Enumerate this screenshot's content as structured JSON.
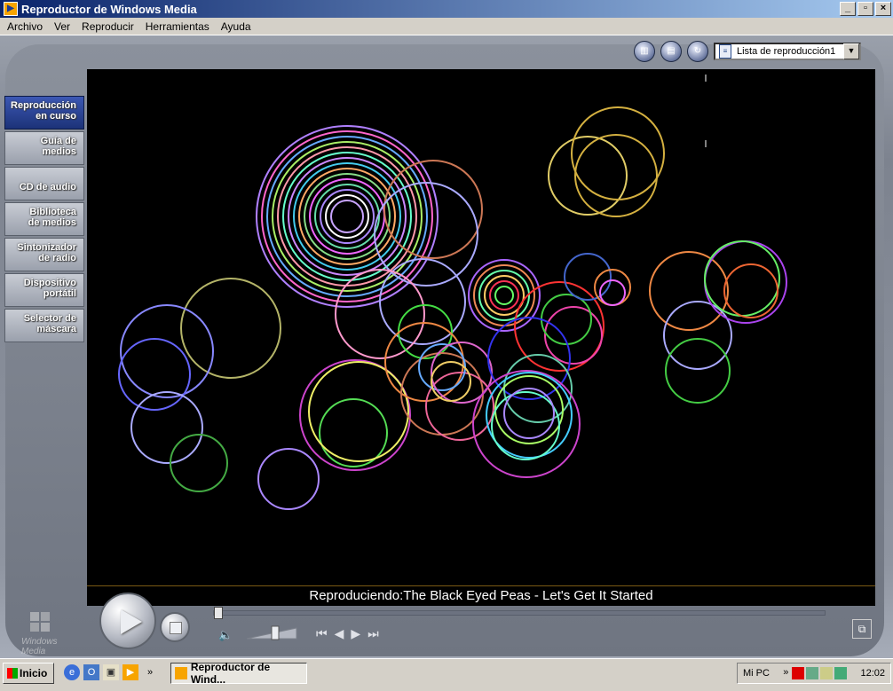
{
  "window": {
    "title": "Reproductor de Windows Media",
    "controls": [
      "_",
      "▫",
      "×"
    ]
  },
  "menu": [
    "Archivo",
    "Ver",
    "Reproducir",
    "Herramientas",
    "Ayuda"
  ],
  "toolbar": {
    "playlist_value": "Lista de reproducción1"
  },
  "sidebar": {
    "items": [
      {
        "label": "Reproducción\nen curso",
        "active": true
      },
      {
        "label": "Guía de\nmedios"
      },
      {
        "label": "CD de audio"
      },
      {
        "label": "Biblioteca\nde medios"
      },
      {
        "label": "Sintonizador\nde radio"
      },
      {
        "label": "Dispositivo\nportátil"
      },
      {
        "label": "Selector de\nmáscara"
      }
    ]
  },
  "status": {
    "now_playing": "Reproduciendo:The Black Eyed Peas - Let's Get It Started"
  },
  "logo": {
    "text": "Windows Media"
  },
  "taskbar": {
    "start_label": "Inicio",
    "task_label": "Reproductor de Wind...",
    "mypc_label": "Mi PC",
    "clock": "12:02",
    "chevron": "»"
  },
  "colors": {
    "accent_title": "#0a246a",
    "active_nav": "#1c3278",
    "visual_bg": "#000000"
  }
}
